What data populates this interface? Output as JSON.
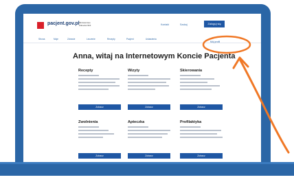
{
  "site": {
    "logo_text": "pacjent.gov.pl",
    "logo_subtitle": "Ministerstwo Zdrowia NFZ",
    "links": [
      "Kontakt",
      "Szukaj",
      "Zaloguj się"
    ],
    "nav": [
      "Strona",
      "Moje",
      "Zdrowie",
      "Leczenie",
      "Recepty",
      "Pacjent",
      "Ustawienia"
    ],
    "profile_link": "Mój profil",
    "heading": "Anna, witaj na Internetowym Koncie Pacjenta"
  },
  "cards": [
    {
      "title": "Recepty",
      "button": "Zobacz"
    },
    {
      "title": "Wizyty",
      "button": "Zobacz"
    },
    {
      "title": "Skierowania",
      "button": "Zobacz"
    },
    {
      "title": "Zwolnienia",
      "button": "Zobacz"
    },
    {
      "title": "Apteczka",
      "button": "Zobacz"
    },
    {
      "title": "Profilaktyka",
      "button": "Zobacz"
    }
  ],
  "annotation": {
    "color": "#f07826",
    "target": "profile_link"
  },
  "colors": {
    "laptop_frame": "#2b66a6",
    "accent": "#1f57a4",
    "logo_red": "#d9202a"
  }
}
